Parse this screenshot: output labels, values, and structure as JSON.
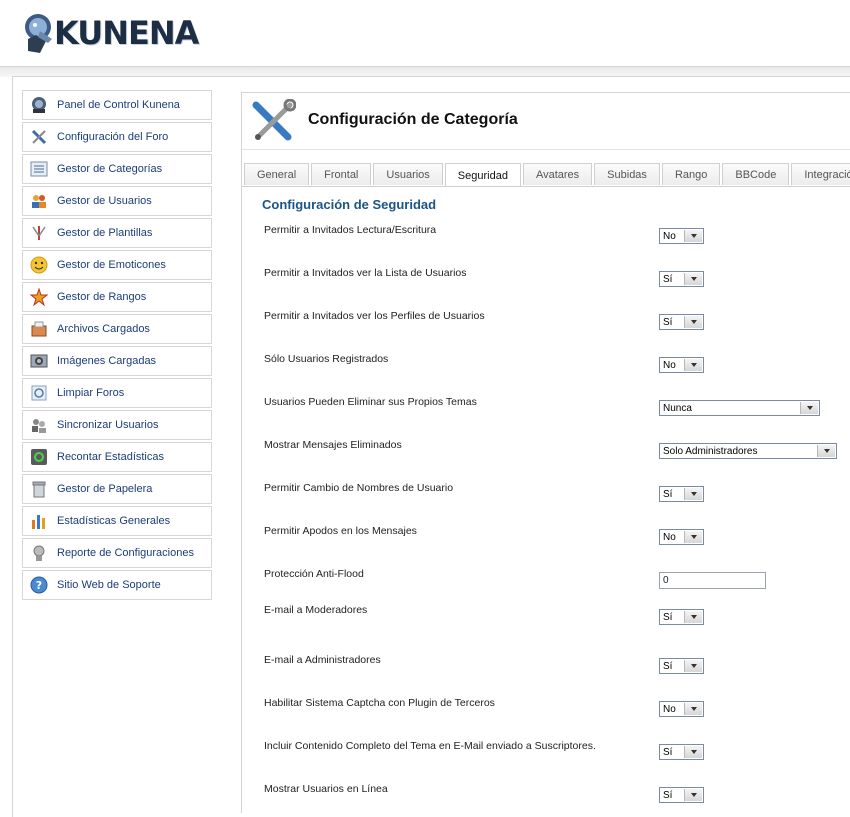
{
  "header": {
    "logo_text": "KUNENA"
  },
  "sidebar": {
    "items": [
      {
        "label": "Panel de Control Kunena",
        "icon": "kunena-panel-icon"
      },
      {
        "label": "Configuración del Foro",
        "icon": "tools-icon"
      },
      {
        "label": "Gestor de Categorías",
        "icon": "categories-icon"
      },
      {
        "label": "Gestor de Usuarios",
        "icon": "users-icon"
      },
      {
        "label": "Gestor de Plantillas",
        "icon": "templates-icon"
      },
      {
        "label": "Gestor de Emoticones",
        "icon": "smiley-icon"
      },
      {
        "label": "Gestor de Rangos",
        "icon": "ranks-star-icon"
      },
      {
        "label": "Archivos Cargados",
        "icon": "files-icon"
      },
      {
        "label": "Imágenes Cargadas",
        "icon": "images-icon"
      },
      {
        "label": "Limpiar Foros",
        "icon": "clean-icon"
      },
      {
        "label": "Sincronizar Usuarios",
        "icon": "sync-users-icon"
      },
      {
        "label": "Recontar Estadísticas",
        "icon": "recount-icon"
      },
      {
        "label": "Gestor de Papelera",
        "icon": "trash-icon"
      },
      {
        "label": "Estadísticas Generales",
        "icon": "stats-icon"
      },
      {
        "label": "Reporte de Configuraciones",
        "icon": "report-icon"
      },
      {
        "label": "Sitio Web de Soporte",
        "icon": "help-icon"
      }
    ]
  },
  "main": {
    "title": "Configuración de Categoría",
    "tabs": [
      "General",
      "Frontal",
      "Usuarios",
      "Seguridad",
      "Avatares",
      "Subidas",
      "Rango",
      "BBCode",
      "Integración"
    ],
    "active_tab": "Seguridad",
    "section_title": "Configuración de Seguridad",
    "settings": [
      {
        "label": "Permitir a Invitados Lectura/Escritura",
        "value": "No"
      },
      {
        "label": "Permitir a Invitados ver la Lista de Usuarios",
        "value": "Sí"
      },
      {
        "label": "Permitir a Invitados ver los Perfiles de Usuarios",
        "value": "Sí"
      },
      {
        "label": "Sólo Usuarios Registrados",
        "value": "No"
      },
      {
        "label": "Usuarios Pueden Eliminar sus Propios Temas",
        "value": "Nunca"
      },
      {
        "label": "Mostrar Mensajes Eliminados",
        "value": "Solo Administradores"
      },
      {
        "label": "Permitir Cambio de Nombres de Usuario",
        "value": "Sí"
      },
      {
        "label": "Permitir Apodos en los Mensajes",
        "value": "No"
      },
      {
        "label": "Protección Anti-Flood",
        "value": "0"
      },
      {
        "label": "E-mail a Moderadores",
        "value": "Sí"
      },
      {
        "label": "E-mail a Administradores",
        "value": "Sí"
      },
      {
        "label": "Habilitar Sistema Captcha con Plugin de Terceros",
        "value": "No"
      },
      {
        "label": "Incluir Contenido Completo del Tema en E-Mail enviado a Suscriptores.",
        "value": "Sí"
      },
      {
        "label": "Mostrar Usuarios en Línea",
        "value": "Sí"
      }
    ]
  }
}
